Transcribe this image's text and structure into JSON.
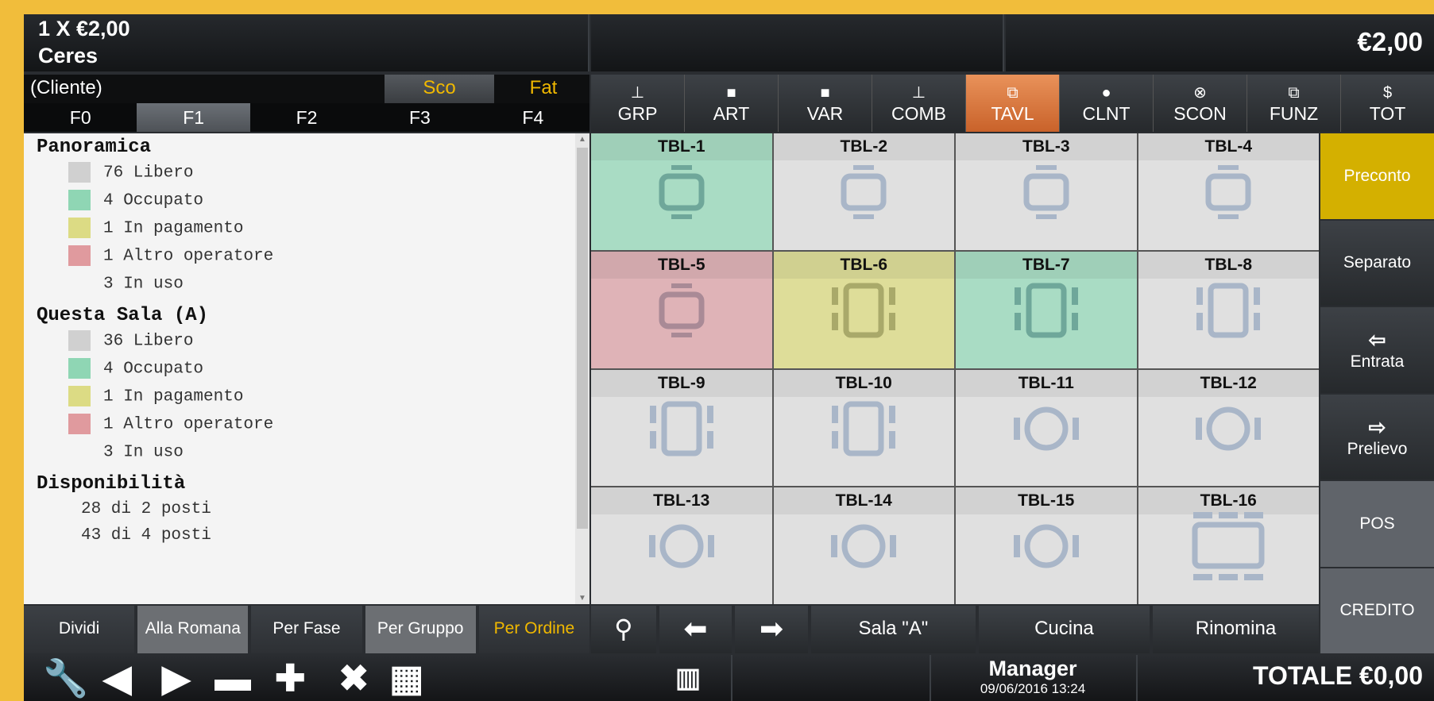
{
  "header": {
    "qty_line": "1  X €2,00",
    "item": "Ceres",
    "price": "€2,00"
  },
  "client": {
    "label": "(Cliente)",
    "sco": "Sco",
    "fat": "Fat"
  },
  "ftabs": [
    "F0",
    "F1",
    "F2",
    "F3",
    "F4"
  ],
  "panel": {
    "sec1": "Panoramica",
    "sec1_rows": [
      "76 Libero",
      "4 Occupato",
      "1 In pagamento",
      "1 Altro operatore",
      "3 In uso"
    ],
    "sec2": "Questa Sala (A)",
    "sec2_rows": [
      "36 Libero",
      "4 Occupato",
      "1 In pagamento",
      "1 Altro operatore",
      "3 In uso"
    ],
    "sec3": "Disponibilità",
    "sec3_rows": [
      "28 di 2 posti",
      "43 di 4 posti"
    ]
  },
  "left_buttons": [
    "Dividi",
    "Alla Romana",
    "Per Fase",
    "Per Gruppo",
    "Per Ordine"
  ],
  "toolbar": [
    {
      "label": "GRP",
      "icon": "sitemap-icon"
    },
    {
      "label": "ART",
      "icon": "square-icon"
    },
    {
      "label": "VAR",
      "icon": "square-icon"
    },
    {
      "label": "COMB",
      "icon": "sitemap-icon"
    },
    {
      "label": "TAVL",
      "icon": "tables-icon"
    },
    {
      "label": "CLNT",
      "icon": "user-icon"
    },
    {
      "label": "SCON",
      "icon": "discount-icon"
    },
    {
      "label": "FUNZ",
      "icon": "functions-icon"
    },
    {
      "label": "TOT",
      "icon": "dollar-icon"
    }
  ],
  "tables": [
    {
      "name": "TBL-1",
      "status": "occupied"
    },
    {
      "name": "TBL-2",
      "status": "free"
    },
    {
      "name": "TBL-3",
      "status": "free"
    },
    {
      "name": "TBL-4",
      "status": "free"
    },
    {
      "name": "TBL-5",
      "status": "other"
    },
    {
      "name": "TBL-6",
      "status": "paying"
    },
    {
      "name": "TBL-7",
      "status": "occupied"
    },
    {
      "name": "TBL-8",
      "status": "free"
    },
    {
      "name": "TBL-9",
      "status": "free"
    },
    {
      "name": "TBL-10",
      "status": "free"
    },
    {
      "name": "TBL-11",
      "status": "free"
    },
    {
      "name": "TBL-12",
      "status": "free"
    },
    {
      "name": "TBL-13",
      "status": "free"
    },
    {
      "name": "TBL-14",
      "status": "free"
    },
    {
      "name": "TBL-15",
      "status": "free"
    },
    {
      "name": "TBL-16",
      "status": "free"
    }
  ],
  "side": {
    "preconto": "Preconto",
    "separato": "Separato",
    "entrata": "Entrata",
    "prelievo": "Prelievo",
    "pos": "POS",
    "credito": "CREDITO"
  },
  "nav": {
    "room": "Sala \"A\"",
    "kitchen": "Cucina",
    "rename": "Rinomina"
  },
  "footer": {
    "user": "Manager",
    "datetime": "09/06/2016  13:24",
    "total": "TOTALE €0,00"
  },
  "colors": {
    "occupied": "#a9dcc4",
    "paying": "#dedd99",
    "other": "#dfb3b7",
    "free": "#e0e0e0",
    "inuse": "#cfcfcf",
    "accent": "#f0b800",
    "active_tab": "#d9733b"
  }
}
